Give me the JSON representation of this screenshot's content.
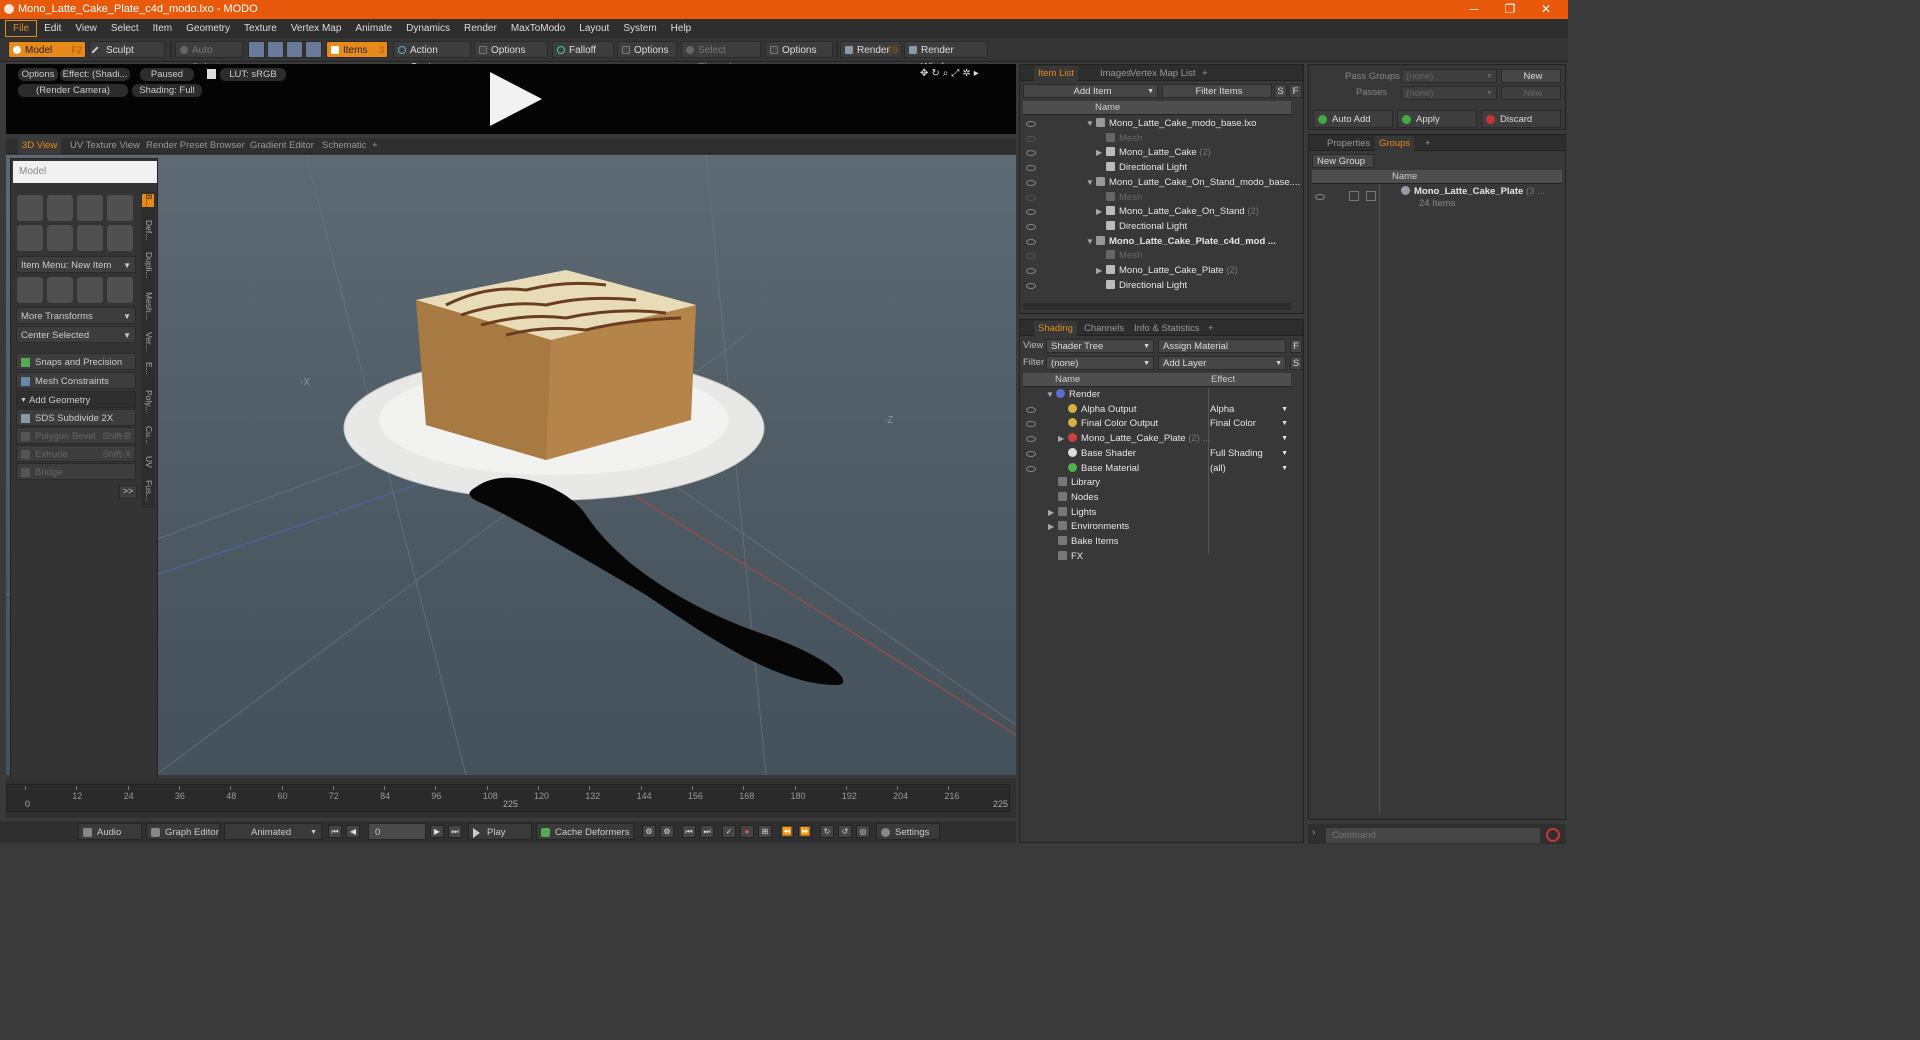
{
  "window": {
    "title": "Mono_Latte_Cake_Plate_c4d_modo.lxo - MODO",
    "minimize": "─",
    "restore": "❐",
    "close": "✕"
  },
  "menu": [
    "File",
    "Edit",
    "View",
    "Select",
    "Item",
    "Geometry",
    "Texture",
    "Vertex Map",
    "Animate",
    "Dynamics",
    "Render",
    "MaxToModo",
    "Layout",
    "System",
    "Help"
  ],
  "toolbar": {
    "model": "Model",
    "model_key": "F2",
    "sculpt": "Sculpt",
    "auto_select": "Auto Select",
    "items": "Items",
    "items_key": "3",
    "action_center": "Action Center",
    "options1": "Options",
    "falloff": "Falloff",
    "options2": "Options",
    "select_through": "Select Through",
    "options3": "Options",
    "render": "Render",
    "render_key": "F9",
    "render_window": "Render Window"
  },
  "preview": {
    "options": "Options",
    "effect": "Effect: (Shadi...",
    "paused": "Paused",
    "lut": "LUT: sRGB",
    "camera": "(Render Camera)",
    "shading": "Shading: Full"
  },
  "view_tabs": [
    "3D View",
    "UV Texture View",
    "Render Preset Browser",
    "Gradient Editor",
    "Schematic",
    "+"
  ],
  "model_panel": {
    "title": "Model",
    "item_menu": "Item Menu: New Item",
    "more_transforms": "More Transforms",
    "center_selected": "Center Selected",
    "snaps": "Snaps and Precision",
    "mesh_constraints": "Mesh Constraints",
    "add_geometry": "Add Geometry",
    "sds": "SDS Subdivide 2X",
    "polygon_bevel": "Polygon Bevel",
    "polygon_bevel_key": "Shift-B",
    "extrude": "Extrude",
    "extrude_key": "Shift-X",
    "bridge": "Bridge",
    "more": ">>",
    "vtabs": [
      "B...",
      "Def...",
      "Dupli...",
      "Mesh...",
      "Ver...",
      "E...",
      "Poly...",
      "Cu...",
      "UV",
      "Fus..."
    ]
  },
  "viewport": {
    "axis_neg_x": "-X",
    "axis_z": "-Z"
  },
  "timeline": {
    "ticks": [
      "0",
      "12",
      "24",
      "36",
      "48",
      "60",
      "72",
      "84",
      "96",
      "108",
      "120",
      "132",
      "144",
      "156",
      "168",
      "180",
      "192",
      "204",
      "216"
    ],
    "end": "225",
    "mid": "225",
    "start": "0"
  },
  "bottom": {
    "audio": "Audio",
    "graph_editor": "Graph Editor",
    "animated": "Animated",
    "frame": "0",
    "play": "Play",
    "cache_deformers": "Cache Deformers",
    "settings": "Settings"
  },
  "item_list": {
    "tabs": [
      "Item List",
      "Images",
      "Vertex Map List",
      "+"
    ],
    "add_item": "Add Item",
    "filter_items": "Filter Items",
    "s": "S",
    "f": "F",
    "name_header": "Name",
    "rows": [
      {
        "label": "Mono_Latte_Cake_modo_base.lxo",
        "cnt": "",
        "indent": 0,
        "arrow": "▼",
        "dim": false,
        "bold": false
      },
      {
        "label": "Mesh",
        "cnt": "",
        "indent": 1,
        "arrow": "",
        "dim": true,
        "bold": false
      },
      {
        "label": "Mono_Latte_Cake",
        "cnt": "(2)",
        "indent": 1,
        "arrow": "▶",
        "dim": false,
        "bold": false
      },
      {
        "label": "Directional Light",
        "cnt": "",
        "indent": 1,
        "arrow": "",
        "dim": false,
        "bold": false
      },
      {
        "label": "Mono_Latte_Cake_On_Stand_modo_base....",
        "cnt": "",
        "indent": 0,
        "arrow": "▼",
        "dim": false,
        "bold": false
      },
      {
        "label": "Mesh",
        "cnt": "",
        "indent": 1,
        "arrow": "",
        "dim": true,
        "bold": false
      },
      {
        "label": "Mono_Latte_Cake_On_Stand",
        "cnt": "(2)",
        "indent": 1,
        "arrow": "▶",
        "dim": false,
        "bold": false
      },
      {
        "label": "Directional Light",
        "cnt": "",
        "indent": 1,
        "arrow": "",
        "dim": false,
        "bold": false
      },
      {
        "label": "Mono_Latte_Cake_Plate_c4d_mod ...",
        "cnt": "",
        "indent": 0,
        "arrow": "▼",
        "dim": false,
        "bold": true
      },
      {
        "label": "Mesh",
        "cnt": "",
        "indent": 1,
        "arrow": "",
        "dim": true,
        "bold": false
      },
      {
        "label": "Mono_Latte_Cake_Plate",
        "cnt": "(2)",
        "indent": 1,
        "arrow": "▶",
        "dim": false,
        "bold": false
      },
      {
        "label": "Directional Light",
        "cnt": "",
        "indent": 1,
        "arrow": "",
        "dim": false,
        "bold": false
      }
    ]
  },
  "shading": {
    "tabs": [
      "Shading",
      "Channels",
      "Info & Statistics",
      "+"
    ],
    "view_label": "View",
    "view_value": "Shader Tree",
    "assign_material": "Assign Material",
    "f": "F",
    "filter_label": "Filter",
    "filter_value": "(none)",
    "add_layer": "Add Layer",
    "s": "S",
    "name_header": "Name",
    "effect_header": "Effect",
    "rows": [
      {
        "label": "Render",
        "cnt": "",
        "effect": "",
        "indent": 0,
        "arrow": "▼",
        "eye": false,
        "color": "#5a6fd0"
      },
      {
        "label": "Alpha Output",
        "cnt": "",
        "effect": "Alpha",
        "indent": 1,
        "arrow": "",
        "eye": true,
        "color": "#d8b040"
      },
      {
        "label": "Final Color Output",
        "cnt": "",
        "effect": "Final Color",
        "indent": 1,
        "arrow": "",
        "eye": true,
        "color": "#d8b040"
      },
      {
        "label": "Mono_Latte_Cake_Plate",
        "cnt": "(2) ...",
        "effect": "",
        "indent": 1,
        "arrow": "▶",
        "eye": true,
        "color": "#d04040"
      },
      {
        "label": "Base Shader",
        "cnt": "",
        "effect": "Full Shading",
        "indent": 1,
        "arrow": "",
        "eye": true,
        "color": "#dddddd"
      },
      {
        "label": "Base Material",
        "cnt": "",
        "effect": "(all)",
        "indent": 1,
        "arrow": "",
        "eye": true,
        "color": "#50b050"
      },
      {
        "label": "Library",
        "cnt": "",
        "effect": "",
        "indent": 0,
        "arrow": "",
        "eye": false,
        "color": ""
      },
      {
        "label": "Nodes",
        "cnt": "",
        "effect": "",
        "indent": 0,
        "arrow": "",
        "eye": false,
        "color": ""
      },
      {
        "label": "Lights",
        "cnt": "",
        "effect": "",
        "indent": 0,
        "arrow": "▶",
        "eye": false,
        "color": ""
      },
      {
        "label": "Environments",
        "cnt": "",
        "effect": "",
        "indent": 0,
        "arrow": "▶",
        "eye": false,
        "color": ""
      },
      {
        "label": "Bake Items",
        "cnt": "",
        "effect": "",
        "indent": 0,
        "arrow": "",
        "eye": false,
        "color": ""
      },
      {
        "label": "FX",
        "cnt": "",
        "effect": "",
        "indent": 0,
        "arrow": "",
        "eye": false,
        "color": ""
      }
    ]
  },
  "groups": {
    "pass_groups_label": "Pass Groups",
    "pass_groups_value": "(none)",
    "new": "New",
    "passes_label": "Passes",
    "passes_value": "(none)",
    "new2": "New",
    "auto_add": "Auto Add",
    "apply": "Apply",
    "discard": "Discard",
    "tabs": [
      "Properties",
      "Groups",
      "+"
    ],
    "new_group": "New Group",
    "name_header": "Name",
    "group_name": "Mono_Latte_Cake_Plate",
    "group_cnt": "(3 ...",
    "group_items": "24 Items"
  },
  "command": {
    "placeholder": "Command"
  },
  "colors": {
    "accent": "#e88a1a",
    "titlebar": "#e8590c"
  }
}
